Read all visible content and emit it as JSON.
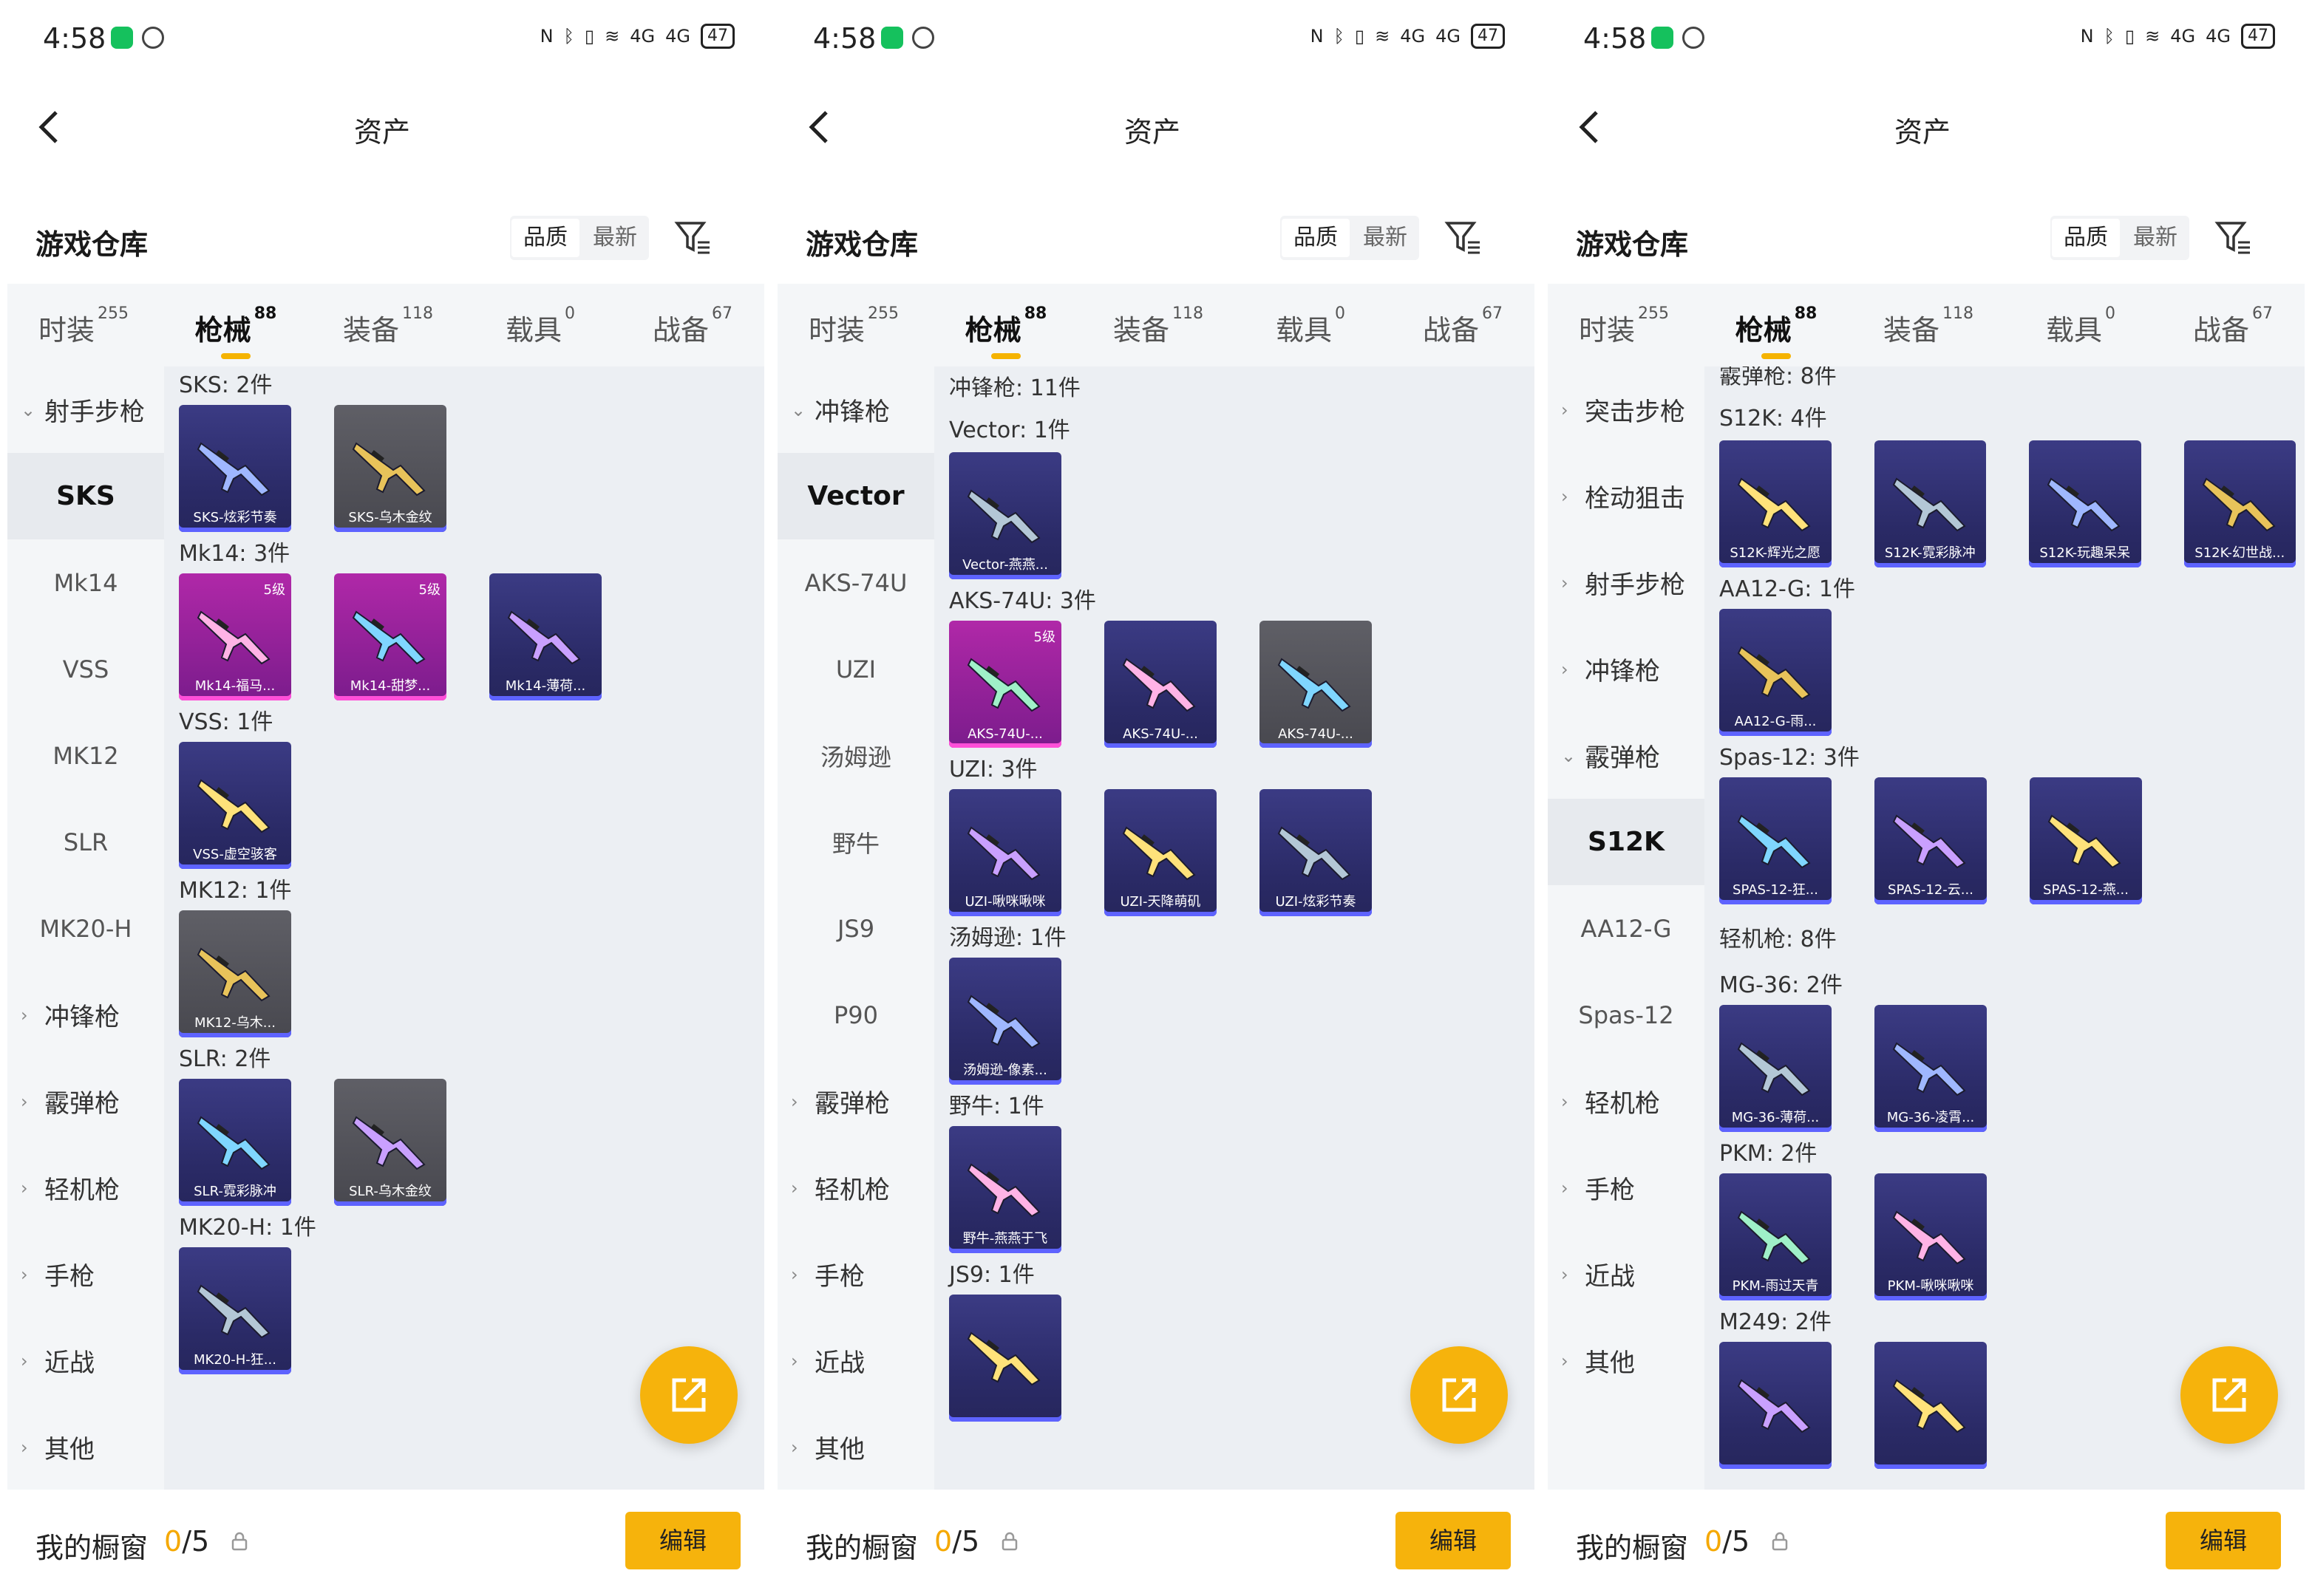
{
  "status": {
    "time": "4:58",
    "battery": "47",
    "net1": "4G",
    "net2": "4G"
  },
  "nav": {
    "title": "资产"
  },
  "warehouse": {
    "title": "游戏仓库",
    "sort_quality": "品质",
    "sort_latest": "最新"
  },
  "tabs": [
    {
      "label": "时装",
      "count": "255"
    },
    {
      "label": "枪械",
      "count": "88"
    },
    {
      "label": "装备",
      "count": "118"
    },
    {
      "label": "载具",
      "count": "0"
    },
    {
      "label": "战备",
      "count": "67"
    }
  ],
  "bottom": {
    "showcase_label": "我的橱窗",
    "count_used": "0",
    "count_total": "/5",
    "edit_label": "编辑"
  },
  "screens": [
    {
      "sidebar": [
        {
          "label": "射手步枪",
          "type": "cat",
          "open": true
        },
        {
          "label": "SKS",
          "type": "sub",
          "active": true
        },
        {
          "label": "Mk14",
          "type": "sub"
        },
        {
          "label": "VSS",
          "type": "sub"
        },
        {
          "label": "MK12",
          "type": "sub"
        },
        {
          "label": "SLR",
          "type": "sub"
        },
        {
          "label": "MK20-H",
          "type": "sub"
        },
        {
          "label": "冲锋枪",
          "type": "cat"
        },
        {
          "label": "霰弹枪",
          "type": "cat"
        },
        {
          "label": "轻机枪",
          "type": "cat"
        },
        {
          "label": "手枪",
          "type": "cat"
        },
        {
          "label": "近战",
          "type": "cat"
        },
        {
          "label": "其他",
          "type": "cat"
        }
      ],
      "offset": 4,
      "groups": [
        {
          "header": "SKS: 2件",
          "items": [
            {
              "label": "SKS-炫彩节奏",
              "style": "blue"
            },
            {
              "label": "SKS-乌木金纹",
              "style": "grey"
            }
          ]
        },
        {
          "header": "Mk14: 3件",
          "items": [
            {
              "label": "Mk14-福马...",
              "style": "pink",
              "level": "5级"
            },
            {
              "label": "Mk14-甜梦...",
              "style": "pink",
              "level": "5级"
            },
            {
              "label": "Mk14-薄荷...",
              "style": "blue"
            }
          ]
        },
        {
          "header": "VSS: 1件",
          "items": [
            {
              "label": "VSS-虚空骇客",
              "style": "blue"
            }
          ]
        },
        {
          "header": "MK12: 1件",
          "items": [
            {
              "label": "MK12-乌木...",
              "style": "grey"
            }
          ]
        },
        {
          "header": "SLR: 2件",
          "items": [
            {
              "label": "SLR-霓彩脉冲",
              "style": "blue"
            },
            {
              "label": "SLR-乌木金纹",
              "style": "grey"
            }
          ]
        },
        {
          "header": "MK20-H: 1件",
          "items": [
            {
              "label": "MK20-H-狂...",
              "style": "blue"
            }
          ]
        }
      ]
    },
    {
      "sidebar": [
        {
          "label": "冲锋枪",
          "type": "cat",
          "open": true
        },
        {
          "label": "Vector",
          "type": "sub",
          "active": true
        },
        {
          "label": "AKS-74U",
          "type": "sub"
        },
        {
          "label": "UZI",
          "type": "sub"
        },
        {
          "label": "汤姆逊",
          "type": "sub"
        },
        {
          "label": "野牛",
          "type": "sub"
        },
        {
          "label": "JS9",
          "type": "sub"
        },
        {
          "label": "P90",
          "type": "sub"
        },
        {
          "label": "霰弹枪",
          "type": "cat"
        },
        {
          "label": "轻机枪",
          "type": "cat"
        },
        {
          "label": "手枪",
          "type": "cat"
        },
        {
          "label": "近战",
          "type": "cat"
        },
        {
          "label": "其他",
          "type": "cat"
        }
      ],
      "offset": 8,
      "category_header": "冲锋枪: 11件",
      "groups": [
        {
          "header": "Vector: 1件",
          "items": [
            {
              "label": "Vector-燕燕...",
              "style": "blue"
            }
          ]
        },
        {
          "header": "AKS-74U: 3件",
          "items": [
            {
              "label": "AKS-74U-...",
              "style": "pink",
              "level": "5级"
            },
            {
              "label": "AKS-74U-...",
              "style": "blue"
            },
            {
              "label": "AKS-74U-...",
              "style": "grey"
            }
          ]
        },
        {
          "header": "UZI: 3件",
          "items": [
            {
              "label": "UZI-啾咪啾咪",
              "style": "blue"
            },
            {
              "label": "UZI-天降萌矶",
              "style": "blue"
            },
            {
              "label": "UZI-炫彩节奏",
              "style": "blue"
            }
          ]
        },
        {
          "header": "汤姆逊: 1件",
          "items": [
            {
              "label": "汤姆逊-像素...",
              "style": "blue"
            }
          ]
        },
        {
          "header": "野牛: 1件",
          "items": [
            {
              "label": "野牛-燕燕于飞",
              "style": "blue"
            }
          ]
        },
        {
          "header": "JS9: 1件",
          "items": [
            {
              "label": "",
              "style": "blue"
            }
          ]
        }
      ]
    },
    {
      "sidebar": [
        {
          "label": "突击步枪",
          "type": "cat"
        },
        {
          "label": "栓动狙击",
          "type": "cat"
        },
        {
          "label": "射手步枪",
          "type": "cat"
        },
        {
          "label": "冲锋枪",
          "type": "cat"
        },
        {
          "label": "霰弹枪",
          "type": "cat",
          "open": true
        },
        {
          "label": "S12K",
          "type": "sub",
          "active": true
        },
        {
          "label": "AA12-G",
          "type": "sub"
        },
        {
          "label": "Spas-12",
          "type": "sub"
        },
        {
          "label": "轻机枪",
          "type": "cat"
        },
        {
          "label": "手枪",
          "type": "cat"
        },
        {
          "label": "近战",
          "type": "cat"
        },
        {
          "label": "其他",
          "type": "cat"
        }
      ],
      "offset": -8,
      "category_header": "霰弹枪: 8件",
      "groups": [
        {
          "header": "S12K: 4件",
          "items": [
            {
              "label": "S12K-辉光之愿",
              "style": "blue"
            },
            {
              "label": "S12K-霓彩脉冲",
              "style": "blue"
            },
            {
              "label": "S12K-玩趣呆呆",
              "style": "blue"
            },
            {
              "label": "S12K-幻世战...",
              "style": "blue"
            }
          ]
        },
        {
          "header": "AA12-G: 1件",
          "items": [
            {
              "label": "AA12-G-雨...",
              "style": "blue"
            }
          ]
        },
        {
          "header": "Spas-12: 3件",
          "items": [
            {
              "label": "SPAS-12-狂...",
              "style": "blue"
            },
            {
              "label": "SPAS-12-云...",
              "style": "blue"
            },
            {
              "label": "SPAS-12-燕...",
              "style": "blue"
            }
          ]
        },
        {
          "category": "轻机枪: 8件",
          "header": "MG-36: 2件",
          "items": [
            {
              "label": "MG-36-薄荷...",
              "style": "blue"
            },
            {
              "label": "MG-36-凌霄...",
              "style": "blue"
            }
          ]
        },
        {
          "header": "PKM: 2件",
          "items": [
            {
              "label": "PKM-雨过天青",
              "style": "blue"
            },
            {
              "label": "PKM-啾咪啾咪",
              "style": "blue"
            }
          ]
        },
        {
          "header": "M249: 2件",
          "items": [
            {
              "label": "",
              "style": "blue"
            },
            {
              "label": "",
              "style": "blue"
            }
          ]
        }
      ]
    }
  ],
  "colors": {
    "accent": "#f6b30c",
    "tab_underline": "#f5b300",
    "card_blue": "#2f2f72",
    "card_pink": "#9c22a0",
    "card_grey": "#55555c"
  }
}
